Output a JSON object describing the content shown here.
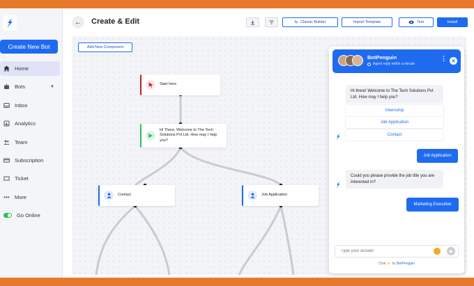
{
  "sidebar": {
    "create_button": "Create New Bot",
    "items": [
      {
        "label": "Home",
        "icon": "home-icon"
      },
      {
        "label": "Bots",
        "icon": "bot-icon"
      },
      {
        "label": "Inbox",
        "icon": "inbox-icon"
      },
      {
        "label": "Analytics",
        "icon": "analytics-icon"
      },
      {
        "label": "Team",
        "icon": "team-icon"
      },
      {
        "label": "Subscription",
        "icon": "subscription-icon"
      },
      {
        "label": "Ticket",
        "icon": "ticket-icon"
      },
      {
        "label": "More",
        "icon": "more-icon"
      },
      {
        "label": "Go Online",
        "icon": "toggle-icon"
      }
    ]
  },
  "header": {
    "title": "Create & Edit",
    "buttons": {
      "classic_builder": "Classic Builder",
      "import_template": "Import Template",
      "test": "Test",
      "install": "Install"
    }
  },
  "canvas": {
    "add_component": "Add New Component",
    "nodes": {
      "start": "Start here",
      "welcome": "Hi There, Welcome to The Tech Solutions Pvt Ltd. How may I help you?",
      "contact": "Contact",
      "job": "Job Application"
    }
  },
  "chat": {
    "bot_name": "BotPenguin",
    "status": "Agent reply within a minute",
    "welcome": "Hi there! Welcome to The Tech Solutions Pvt Ltd. How may I help you?",
    "options": [
      "Internship",
      "Job Application",
      "Contact"
    ],
    "user_reply_1": "Job Application",
    "question": "Could you please provide the job title you are interested in?",
    "user_reply_2": "Marketing Executive",
    "input_placeholder": "Type your answer",
    "powered_prefix": "Chat",
    "powered_by": "by",
    "powered_brand": "BotPenguin"
  },
  "colors": {
    "accent": "#1f6bf0",
    "start_bar": "#c0202a",
    "welcome_bar": "#2fbf5b",
    "online": "#2fbf5b"
  }
}
